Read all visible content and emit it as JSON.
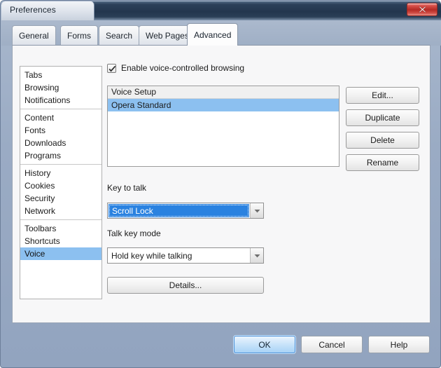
{
  "window": {
    "title": "Preferences",
    "close_icon": "close-icon",
    "accent_blue": "#8cc0f0",
    "selection_blue": "#2a82e0",
    "frame_color": "#9aabc4",
    "titlebar_color": "#23364e",
    "close_button_color": "#b52a25"
  },
  "tabs": [
    {
      "label": "General",
      "selected": false
    },
    {
      "label": "Forms",
      "selected": false
    },
    {
      "label": "Search",
      "selected": false
    },
    {
      "label": "Web Pages",
      "selected": false
    },
    {
      "label": "Advanced",
      "selected": true
    }
  ],
  "sidebar": {
    "groups": [
      {
        "items": [
          {
            "label": "Tabs",
            "selected": false
          },
          {
            "label": "Browsing",
            "selected": false
          },
          {
            "label": "Notifications",
            "selected": false
          }
        ]
      },
      {
        "items": [
          {
            "label": "Content",
            "selected": false
          },
          {
            "label": "Fonts",
            "selected": false
          },
          {
            "label": "Downloads",
            "selected": false
          },
          {
            "label": "Programs",
            "selected": false
          }
        ]
      },
      {
        "items": [
          {
            "label": "History",
            "selected": false
          },
          {
            "label": "Cookies",
            "selected": false
          },
          {
            "label": "Security",
            "selected": false
          },
          {
            "label": "Network",
            "selected": false
          }
        ]
      },
      {
        "items": [
          {
            "label": "Toolbars",
            "selected": false
          },
          {
            "label": "Shortcuts",
            "selected": false
          },
          {
            "label": "Voice",
            "selected": true
          }
        ]
      }
    ]
  },
  "main": {
    "enable_voice": {
      "label": "Enable voice-controlled browsing",
      "checked": true
    },
    "voice_list": {
      "header": "Voice Setup",
      "rows": [
        {
          "label": "Opera Standard",
          "selected": true
        }
      ]
    },
    "list_buttons": [
      {
        "label": "Edit..."
      },
      {
        "label": "Duplicate"
      },
      {
        "label": "Delete"
      },
      {
        "label": "Rename"
      }
    ],
    "key_to_talk": {
      "label": "Key to talk",
      "value": "Scroll Lock",
      "focused": true
    },
    "talk_key_mode": {
      "label": "Talk key mode",
      "value": "Hold key while talking",
      "focused": false
    },
    "details_button": {
      "label": "Details..."
    }
  },
  "footer": {
    "buttons": [
      {
        "label": "OK",
        "default": true
      },
      {
        "label": "Cancel",
        "default": false
      },
      {
        "label": "Help",
        "default": false
      }
    ]
  }
}
